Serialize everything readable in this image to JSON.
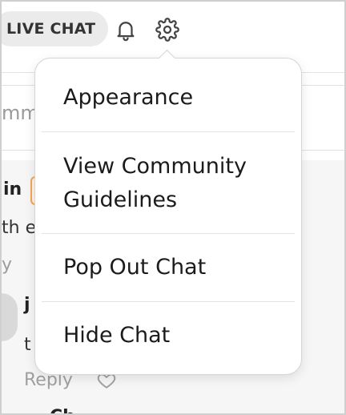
{
  "topbar": {
    "live_chat_label": "LIVE CHAT",
    "bell_icon": "bell-icon",
    "settings_icon": "gear-icon"
  },
  "comment_box": {
    "placeholder": "mm"
  },
  "feed": {
    "comment_1": {
      "author": "in",
      "body": "th e",
      "reply": "y"
    },
    "comment_2": {
      "author": "j",
      "body": "t",
      "reply": "Reply",
      "like_icon": "heart-icon"
    },
    "comment_3": {
      "author": "Ch"
    }
  },
  "settings_menu": {
    "items": [
      {
        "label": "Appearance"
      },
      {
        "label": "View Community Guidelines"
      },
      {
        "label": "Pop Out Chat"
      },
      {
        "label": "Hide Chat"
      }
    ]
  },
  "colors": {
    "pill_bg": "#ebebeb",
    "menu_text": "#1b1b1b",
    "muted_text": "#9c9c9c",
    "badge_orange": "#f2a65a"
  }
}
